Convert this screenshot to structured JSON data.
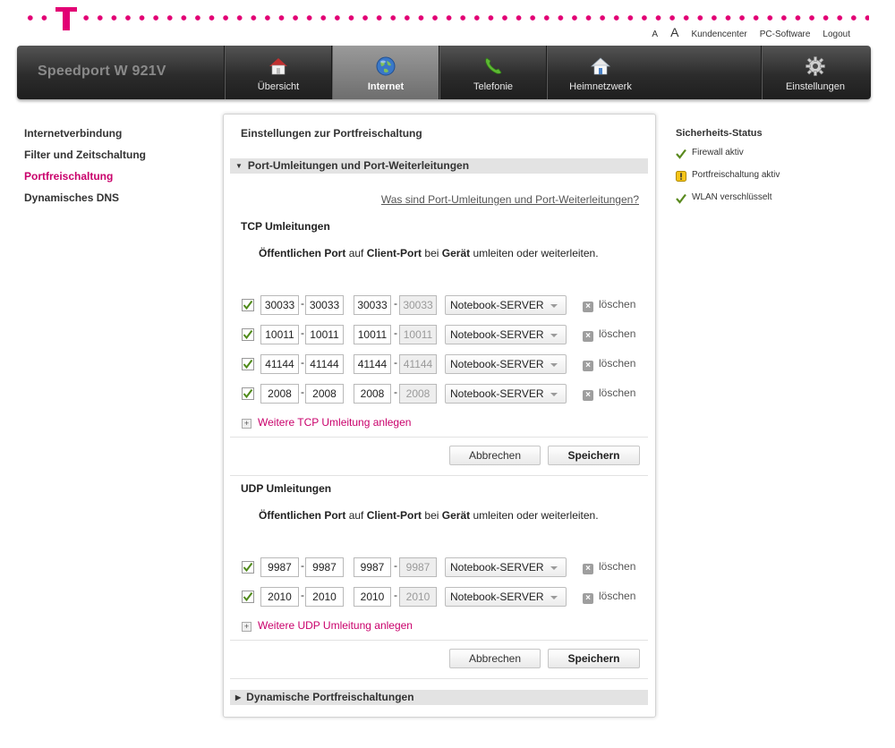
{
  "header": {
    "links": [
      "A",
      "A",
      "Kundencenter",
      "PC-Software",
      "Logout"
    ]
  },
  "nav": {
    "brand": "Speedport W 921V",
    "tabs": [
      {
        "label": "Übersicht",
        "icon": "home-icon"
      },
      {
        "label": "Internet",
        "icon": "globe-icon",
        "active": true
      },
      {
        "label": "Telefonie",
        "icon": "phone-icon"
      },
      {
        "label": "Heimnetzwerk",
        "icon": "home-network-icon"
      },
      {
        "label": "Einstellungen",
        "icon": "gear-icon"
      }
    ]
  },
  "sidebar": {
    "items": [
      {
        "label": "Internetverbindung"
      },
      {
        "label": "Filter und Zeitschaltung"
      },
      {
        "label": "Portfreischaltung",
        "selected": true
      },
      {
        "label": "Dynamisches DNS"
      }
    ]
  },
  "main": {
    "title": "Einstellungen zur Portfreischaltung",
    "section1": "Port-Umleitungen und Port-Weiterleitungen",
    "help_link": "Was sind Port-Umleitungen und Port-Weiterleitungen?",
    "desc": {
      "w1": "Öffentlichen Port",
      "w2": "auf",
      "w3": "Client-Port",
      "w4": "bei",
      "w5": "Gerät",
      "w6": "umleiten oder weiterleiten."
    },
    "tcp": {
      "title": "TCP Umleitungen",
      "rows": [
        {
          "checked": true,
          "pub_from": "30033",
          "pub_to": "30033",
          "cli_from": "30033",
          "cli_to": "30033",
          "device": "Notebook-SERVER",
          "delete": "löschen"
        },
        {
          "checked": true,
          "pub_from": "10011",
          "pub_to": "10011",
          "cli_from": "10011",
          "cli_to": "10011",
          "device": "Notebook-SERVER",
          "delete": "löschen"
        },
        {
          "checked": true,
          "pub_from": "41144",
          "pub_to": "41144",
          "cli_from": "41144",
          "cli_to": "41144",
          "device": "Notebook-SERVER",
          "delete": "löschen"
        },
        {
          "checked": true,
          "pub_from": "2008",
          "pub_to": "2008",
          "cli_from": "2008",
          "cli_to": "2008",
          "device": "Notebook-SERVER",
          "delete": "löschen"
        }
      ],
      "add_label": "Weitere TCP Umleitung anlegen",
      "cancel": "Abbrechen",
      "save": "Speichern"
    },
    "udp": {
      "title": "UDP Umleitungen",
      "rows": [
        {
          "checked": true,
          "pub_from": "9987",
          "pub_to": "9987",
          "cli_from": "9987",
          "cli_to": "9987",
          "device": "Notebook-SERVER",
          "delete": "löschen"
        },
        {
          "checked": true,
          "pub_from": "2010",
          "pub_to": "2010",
          "cli_from": "2010",
          "cli_to": "2010",
          "device": "Notebook-SERVER",
          "delete": "löschen"
        }
      ],
      "add_label": "Weitere UDP Umleitung anlegen",
      "cancel": "Abbrechen",
      "save": "Speichern"
    },
    "section2": "Dynamische Portfreischaltungen"
  },
  "status": {
    "title": "Sicherheits-Status",
    "items": [
      {
        "label": "Firewall aktiv",
        "icon": "check-icon"
      },
      {
        "label": "Portfreischaltung aktiv",
        "icon": "warning-icon"
      },
      {
        "label": "WLAN verschlüsselt",
        "icon": "check-icon"
      }
    ]
  },
  "colors": {
    "brand": "#e20074",
    "link": "#c9006b",
    "check": "#5a8a1f"
  }
}
